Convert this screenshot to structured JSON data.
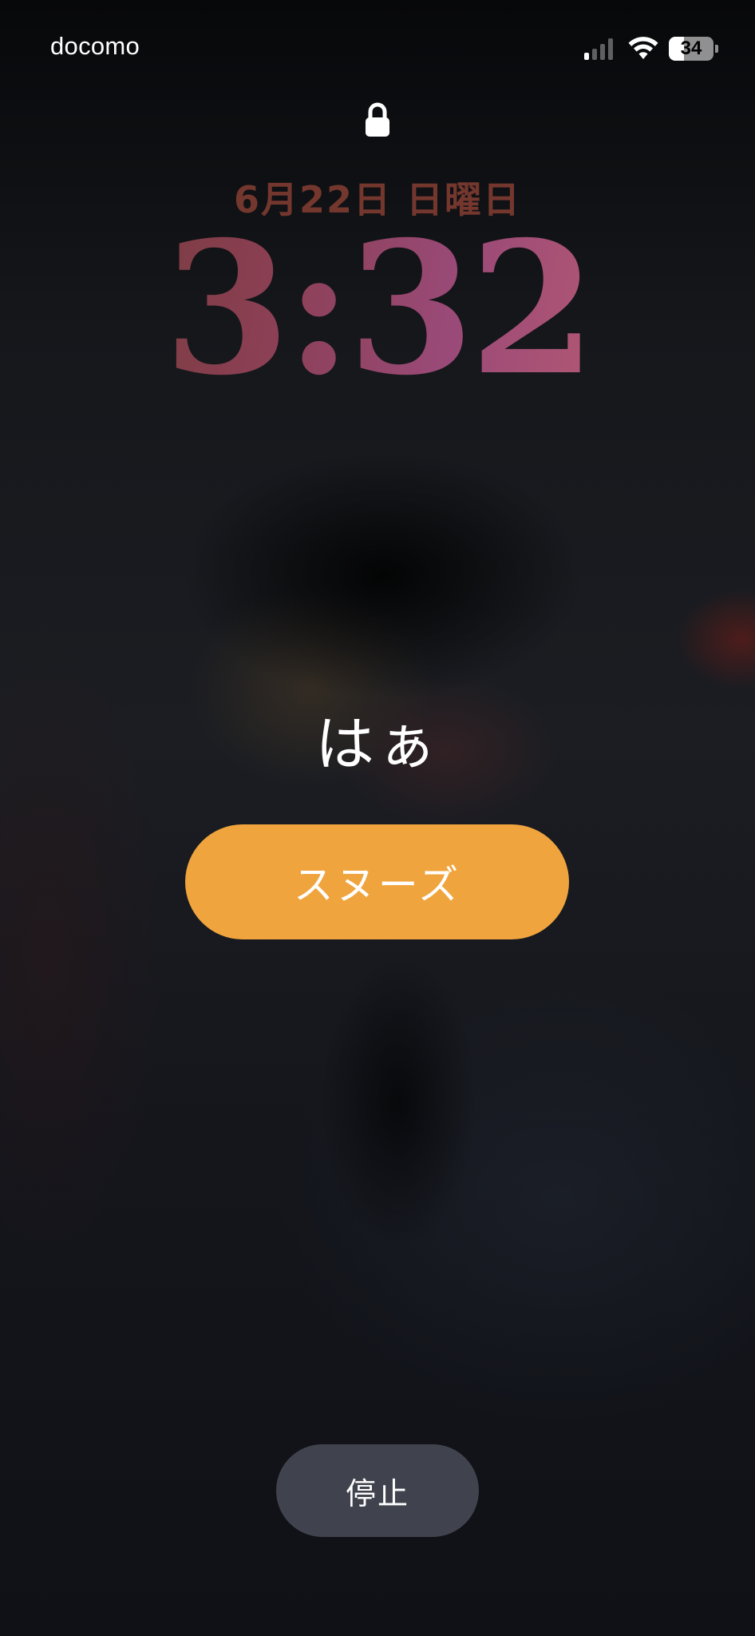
{
  "status_bar": {
    "carrier": "docomo",
    "signal_bars_active": 1,
    "signal_bars_total": 4,
    "wifi_icon": "wifi-icon",
    "battery_level": "34"
  },
  "lock_screen": {
    "lock_icon": "lock-icon",
    "date": "6月22日 日曜日",
    "time": "3:32"
  },
  "alarm": {
    "label": "はぁ",
    "snooze_label": "スヌーズ",
    "stop_label": "停止"
  },
  "colors": {
    "snooze_button": "#f0a43e",
    "stop_button": "#4e505c",
    "date_text": "#7a3a30",
    "time_gradient_start": "#6a3a30",
    "time_gradient_end": "#b85a72"
  }
}
